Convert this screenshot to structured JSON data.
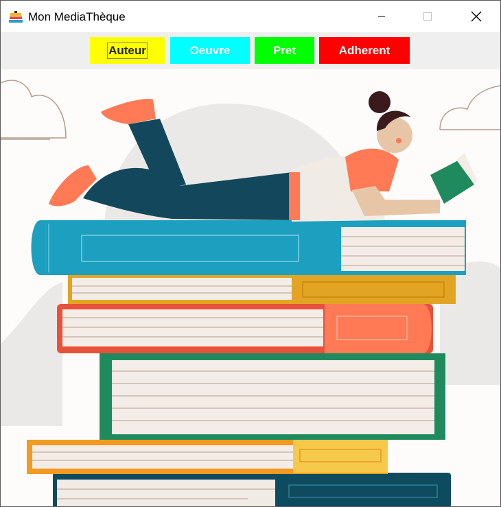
{
  "window": {
    "title": "Mon MediaThèque",
    "icon": "books-icon"
  },
  "toolbar": {
    "buttons": [
      {
        "label": "Auteur",
        "color": "#ffff00"
      },
      {
        "label": "Oeuvre",
        "color": "#00ffff"
      },
      {
        "label": "Pret",
        "color": "#00ff00"
      },
      {
        "label": "Adherent",
        "color": "#ff0000"
      }
    ]
  },
  "illustration": {
    "subject": "reading-woman-on-book-stack"
  }
}
